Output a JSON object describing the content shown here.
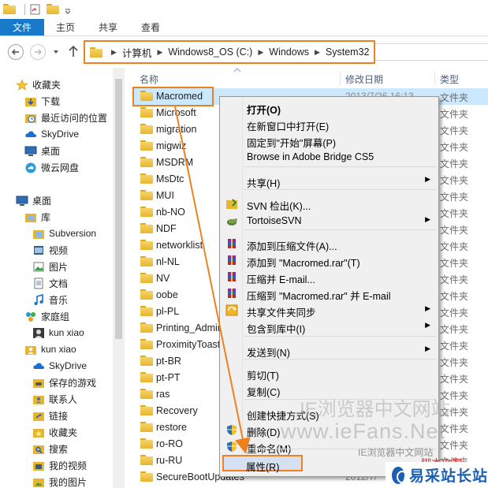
{
  "ribbon": {
    "tabs": [
      {
        "label": "文件"
      },
      {
        "label": "主页"
      },
      {
        "label": "共享"
      },
      {
        "label": "查看"
      }
    ]
  },
  "address": {
    "crumbs": [
      "计算机",
      "Windows8_OS (C:)",
      "Windows",
      "System32"
    ]
  },
  "nav": {
    "items": [
      {
        "label": "收藏夹",
        "icon": "star-icon"
      },
      {
        "label": "下载",
        "icon": "download-folder-icon"
      },
      {
        "label": "最近访问的位置",
        "icon": "recent-places-icon"
      },
      {
        "label": "SkyDrive",
        "icon": "skydrive-icon"
      },
      {
        "label": "桌面",
        "icon": "desktop-icon"
      },
      {
        "label": "微云网盘",
        "icon": "cloud-icon"
      },
      {
        "label": "桌面",
        "icon": "desktop-icon"
      },
      {
        "label": "库",
        "icon": "library-icon"
      },
      {
        "label": "Subversion",
        "icon": "library-icon"
      },
      {
        "label": "视频",
        "icon": "video-library-icon"
      },
      {
        "label": "图片",
        "icon": "pictures-library-icon"
      },
      {
        "label": "文档",
        "icon": "documents-library-icon"
      },
      {
        "label": "音乐",
        "icon": "music-library-icon"
      },
      {
        "label": "家庭组",
        "icon": "homegroup-icon"
      },
      {
        "label": "kun xiao",
        "icon": "user-icon"
      },
      {
        "label": "kun xiao",
        "icon": "user-folder-icon"
      },
      {
        "label": "SkyDrive",
        "icon": "skydrive-icon"
      },
      {
        "label": "保存的游戏",
        "icon": "saved-games-icon"
      },
      {
        "label": "联系人",
        "icon": "contacts-icon"
      },
      {
        "label": "链接",
        "icon": "links-icon"
      },
      {
        "label": "收藏夹",
        "icon": "favorites-folder-icon"
      },
      {
        "label": "搜索",
        "icon": "searches-icon"
      },
      {
        "label": "我的视频",
        "icon": "my-videos-icon"
      },
      {
        "label": "我的图片",
        "icon": "my-pictures-icon"
      }
    ]
  },
  "columns": {
    "name": "名称",
    "date": "修改日期",
    "type": "类型"
  },
  "files": [
    {
      "name": "Macromed",
      "date": "2013/7/26 16:13",
      "type": "文件夹"
    },
    {
      "name": "Microsoft",
      "date": "",
      "type": "文件夹"
    },
    {
      "name": "migration",
      "date": "",
      "type": "文件夹"
    },
    {
      "name": "migwiz",
      "date": "",
      "type": "文件夹"
    },
    {
      "name": "MSDRM",
      "date": "",
      "type": "文件夹"
    },
    {
      "name": "MsDtc",
      "date": "",
      "type": "文件夹"
    },
    {
      "name": "MUI",
      "date": "",
      "type": "文件夹"
    },
    {
      "name": "nb-NO",
      "date": "",
      "type": "文件夹"
    },
    {
      "name": "NDF",
      "date": "",
      "type": "文件夹"
    },
    {
      "name": "networklist",
      "date": "",
      "type": "文件夹"
    },
    {
      "name": "nl-NL",
      "date": "",
      "type": "文件夹"
    },
    {
      "name": "NV",
      "date": "",
      "type": "文件夹"
    },
    {
      "name": "oobe",
      "date": "",
      "type": "文件夹"
    },
    {
      "name": "pl-PL",
      "date": "",
      "type": "文件夹"
    },
    {
      "name": "Printing_Admin",
      "date": "",
      "type": "文件夹"
    },
    {
      "name": "ProximityToast",
      "date": "",
      "type": "文件夹"
    },
    {
      "name": "pt-BR",
      "date": "",
      "type": "文件夹"
    },
    {
      "name": "pt-PT",
      "date": "",
      "type": "文件夹"
    },
    {
      "name": "ras",
      "date": "",
      "type": "文件夹"
    },
    {
      "name": "Recovery",
      "date": "",
      "type": "文件夹"
    },
    {
      "name": "restore",
      "date": "",
      "type": "文件夹"
    },
    {
      "name": "ro-RO",
      "date": "",
      "type": "文件夹"
    },
    {
      "name": "ru-RU",
      "date": "",
      "type": "文件夹"
    },
    {
      "name": "SecureBootUpdates",
      "date": "2012/7/",
      "type": "文件夹"
    }
  ],
  "context_menu": {
    "items": [
      {
        "label": "打开(O)",
        "bold": true
      },
      {
        "label": "在新窗口中打开(E)"
      },
      {
        "label": "固定到\"开始\"屏幕(P)"
      },
      {
        "label": "Browse in Adobe Bridge CS5"
      },
      {
        "label": "共享(H)",
        "submenu": true
      },
      {
        "label": "SVN 检出(K)...",
        "icon": "svn-checkout-icon"
      },
      {
        "label": "TortoiseSVN",
        "icon": "tortoise-svn-icon",
        "submenu": true
      },
      {
        "label": "添加到压缩文件(A)...",
        "icon": "winrar-icon"
      },
      {
        "label": "添加到 \"Macromed.rar\"(T)",
        "icon": "winrar-icon"
      },
      {
        "label": "压缩并 E-mail...",
        "icon": "winrar-icon"
      },
      {
        "label": "压缩到 \"Macromed.rar\" 并 E-mail",
        "icon": "winrar-icon"
      },
      {
        "label": "共享文件夹同步",
        "icon": "sync-icon",
        "submenu": true
      },
      {
        "label": "包含到库中(I)",
        "submenu": true
      },
      {
        "label": "发送到(N)",
        "submenu": true
      },
      {
        "label": "剪切(T)"
      },
      {
        "label": "复制(C)"
      },
      {
        "label": "创建快捷方式(S)"
      },
      {
        "label": "删除(D)",
        "icon": "shield-icon"
      },
      {
        "label": "重命名(M)",
        "icon": "shield-icon"
      },
      {
        "label": "属性(R)"
      }
    ]
  },
  "watermarks": {
    "line1": "IE浏览器中文网站",
    "line2": "www.ieFans.Net",
    "line3": "IE浏览器中文网站",
    "red": "脚本之家",
    "logo": "易采站长站"
  },
  "colors": {
    "accent": "#1979ca",
    "highlight_outline": "#f0801d",
    "selection": "#cce8ff"
  }
}
